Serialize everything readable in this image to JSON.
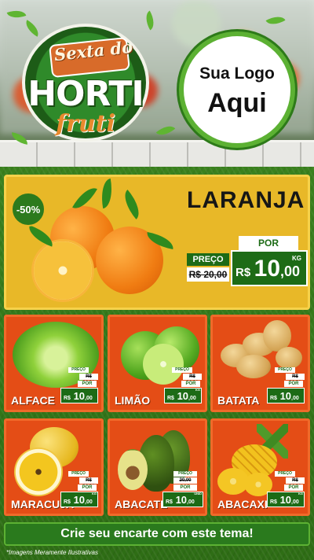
{
  "header": {
    "brand_line1": "Sexta do",
    "brand_line2": "HORTI",
    "brand_line3": "fruti",
    "logo_placeholder_line1": "Sua Logo",
    "logo_placeholder_line2": "Aqui"
  },
  "featured": {
    "discount_badge": "-50%",
    "name": "LARANJA",
    "old_price_label": "PREÇO",
    "old_price": "R$ 20,00",
    "new_price_label": "POR",
    "new_price_currency": "R$",
    "new_price_int": "10",
    "new_price_dec": ",00",
    "unit": "KG"
  },
  "products": [
    {
      "name": "ALFACE",
      "old_price_label": "PREÇO",
      "old_price": "R$ 20,00",
      "new_price_label": "POR",
      "new_price_currency": "R$",
      "new_price_int": "10",
      "new_price_dec": ",00",
      "unit": ""
    },
    {
      "name": "LIMÃO",
      "old_price_label": "PREÇO",
      "old_price": "R$ 20,00",
      "new_price_label": "POR",
      "new_price_currency": "R$",
      "new_price_int": "10",
      "new_price_dec": ",00",
      "unit": "KG"
    },
    {
      "name": "BATATA",
      "old_price_label": "PREÇO",
      "old_price": "R$ 20,00",
      "new_price_label": "POR",
      "new_price_currency": "R$",
      "new_price_int": "10",
      "new_price_dec": ",00",
      "unit": ""
    },
    {
      "name": "MARACUJÁ",
      "old_price_label": "PREÇO",
      "old_price": "R$ 20,00",
      "new_price_label": "POR",
      "new_price_currency": "R$",
      "new_price_int": "10",
      "new_price_dec": ",00",
      "unit": "KG"
    },
    {
      "name": "ABACATE",
      "old_price_label": "PREÇO",
      "old_price": "20,00",
      "new_price_label": "POR",
      "new_price_currency": "R$",
      "new_price_int": "10",
      "new_price_dec": ",00",
      "unit": "UNID"
    },
    {
      "name": "ABACAXI",
      "old_price_label": "PREÇO",
      "old_price": "R$ 20,00",
      "new_price_label": "POR",
      "new_price_currency": "R$",
      "new_price_int": "10",
      "new_price_dec": ",00",
      "unit": "KG"
    }
  ],
  "cta": "Crie seu encarte com este tema!",
  "disclaimer": "*Imagens Meramente Ilustrativas",
  "colors": {
    "green_dark": "#1d6b16",
    "orange_card": "#e44d16",
    "yellow_hero": "#e8b828"
  }
}
